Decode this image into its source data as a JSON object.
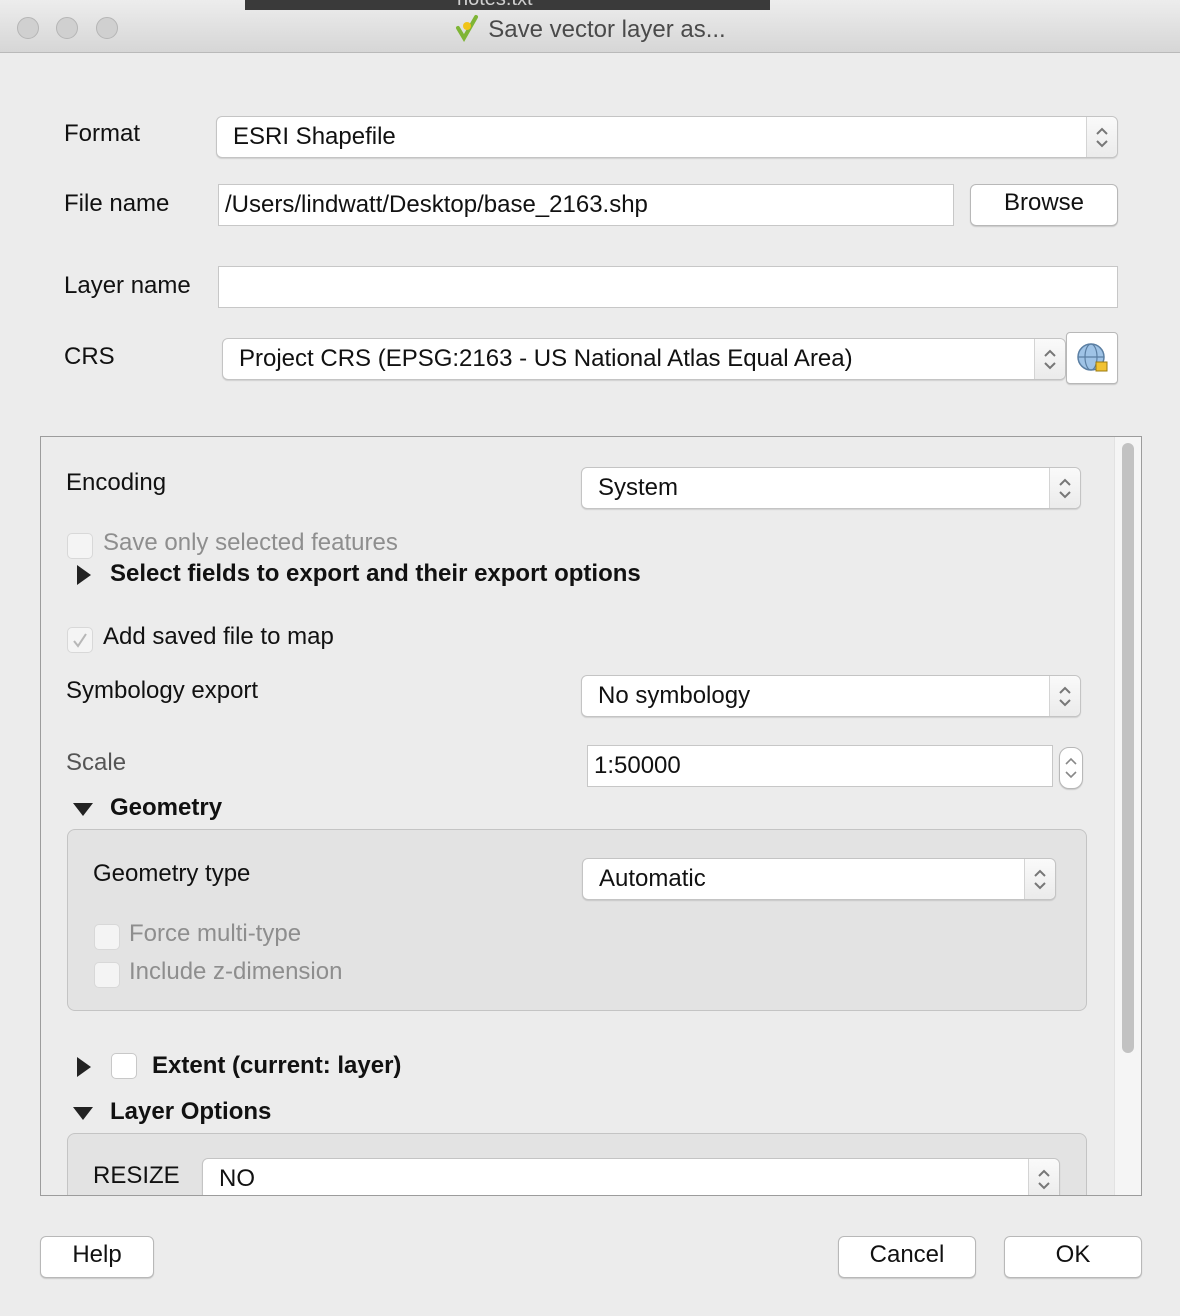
{
  "window": {
    "title": "Save vector layer as...",
    "background_tab_text": "notes.txt"
  },
  "format": {
    "label": "Format",
    "value": "ESRI Shapefile"
  },
  "file_name": {
    "label": "File name",
    "value": "/Users/lindwatt/Desktop/base_2163.shp",
    "browse_label": "Browse"
  },
  "layer_name": {
    "label": "Layer name",
    "value": ""
  },
  "crs": {
    "label": "CRS",
    "value": "Project CRS (EPSG:2163 - US National Atlas Equal Area)",
    "select_icon": "globe-crs-icon"
  },
  "options": {
    "encoding": {
      "label": "Encoding",
      "value": "System"
    },
    "save_selected": {
      "label": "Save only selected features",
      "checked": false,
      "enabled": false
    },
    "select_fields": {
      "label": "Select fields to export and their export options",
      "expanded": false
    },
    "add_to_map": {
      "label": "Add saved file to map",
      "checked": true,
      "enabled": false
    },
    "symbology": {
      "label": "Symbology export",
      "value": "No symbology"
    },
    "scale": {
      "label": "Scale",
      "value": "1:50000"
    },
    "geometry": {
      "label": "Geometry",
      "expanded": true,
      "type_label": "Geometry type",
      "type_value": "Automatic",
      "force_multi": {
        "label": "Force multi-type",
        "checked": false
      },
      "include_z": {
        "label": "Include z-dimension",
        "checked": false
      }
    },
    "extent": {
      "label": "Extent (current: layer)",
      "checked": false,
      "expanded": false
    },
    "layer_options": {
      "label": "Layer Options",
      "expanded": true,
      "resize_label": "RESIZE",
      "resize_value": "NO"
    }
  },
  "buttons": {
    "help": "Help",
    "cancel": "Cancel",
    "ok": "OK"
  },
  "colors": {
    "window_bg": "#ececec",
    "field_bg": "#ffffff",
    "disabled_text": "#8e8e8e"
  }
}
